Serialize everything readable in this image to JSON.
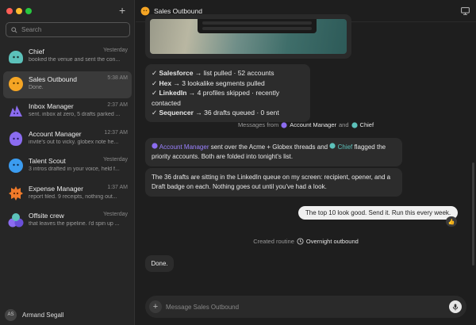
{
  "sidebar": {
    "search_placeholder": "Search",
    "new_button": "+",
    "chats": [
      {
        "title": "Chief",
        "time": "Yesterday",
        "preview": "booked the venue and sent the con...",
        "avatar": "#5cc1ba"
      },
      {
        "title": "Sales Outbound",
        "time": "5:38 AM",
        "preview": "Done.",
        "avatar": "#f5a524"
      },
      {
        "title": "Inbox Manager",
        "time": "2:37 AM",
        "preview": "sent. inbox at zero, 5 drafts parked ...",
        "avatar": "#8b6cf0"
      },
      {
        "title": "Account Manager",
        "time": "12:37 AM",
        "preview": "invite's out to vicky. globex note he...",
        "avatar": "#8b6cf0"
      },
      {
        "title": "Talent Scout",
        "time": "Yesterday",
        "preview": "3 intros drafted in your voice, held f...",
        "avatar": "#3b9cf0"
      },
      {
        "title": "Expense Manager",
        "time": "1:37 AM",
        "preview": "report filed. 9 receipts, nothing out...",
        "avatar": "#f07a2a"
      },
      {
        "title": "Offsite crew",
        "time": "Yesterday",
        "preview": "that leaves the pipeline. i'd spin up ...",
        "avatar": "#8b6cf0"
      }
    ],
    "user": {
      "initials": "AS",
      "name": "Armand Segall"
    }
  },
  "header": {
    "title": "Sales Outbound"
  },
  "checklist": [
    {
      "name": "Salesforce",
      "text": " → list pulled · 52 accounts"
    },
    {
      "name": "Hex",
      "text": " → 3 lookalike segments pulled"
    },
    {
      "name": "LinkedIn",
      "text": " → 4 profiles skipped · recently contacted"
    },
    {
      "name": "Sequencer",
      "text": " → 36 drafts queued · 0 sent"
    }
  ],
  "system_messages": {
    "messages_from": "Messages from",
    "account_manager": "Account Manager",
    "and": "and",
    "chief": "Chief",
    "created_routine": "Created routine",
    "routine_name": "Overnight outbound"
  },
  "msg1": {
    "account_manager": "Account Manager",
    "text_a": " sent over the Acme + Globex threads and ",
    "chief": "Chief",
    "text_b": " flagged the priority accounts. Both are folded into tonight's list."
  },
  "msg2": "The 36 drafts are sitting in the LinkedIn queue on my screen: recipient, opener, and a Draft badge on each. Nothing goes out until you've had a look.",
  "user_msg": "The top 10 look good. Send it. Run this every week.",
  "reaction": "👍",
  "done_msg": "Done.",
  "composer": {
    "placeholder": "Message Sales Outbound"
  }
}
